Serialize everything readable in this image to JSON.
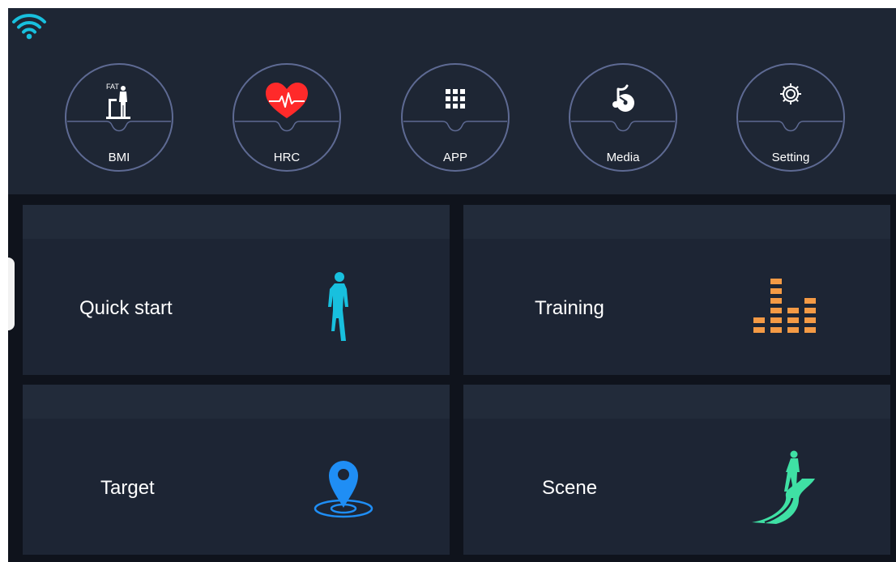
{
  "status_bar": {
    "wifi_icon": "wifi-icon"
  },
  "top_menu": {
    "items": [
      {
        "label": "BMI",
        "icon": "bmi-scale-icon",
        "icon_text": "FAT"
      },
      {
        "label": "HRC",
        "icon": "heart-rate-icon"
      },
      {
        "label": "APP",
        "icon": "app-grid-icon"
      },
      {
        "label": "Media",
        "icon": "media-music-icon"
      },
      {
        "label": "Setting",
        "icon": "gear-icon"
      }
    ]
  },
  "tiles": [
    {
      "label": "Quick start",
      "icon": "runner-icon"
    },
    {
      "label": "Training",
      "icon": "training-bars-icon"
    },
    {
      "label": "Target",
      "icon": "location-pin-icon"
    },
    {
      "label": "Scene",
      "icon": "scene-road-icon"
    }
  ],
  "colors": {
    "accent_cyan": "#18c0de",
    "heart_red": "#ff2a2a",
    "training_orange": "#f49a45",
    "pin_blue": "#1f8ef5",
    "scene_green": "#3fe0a4",
    "circle_border": "#5e6a93"
  }
}
